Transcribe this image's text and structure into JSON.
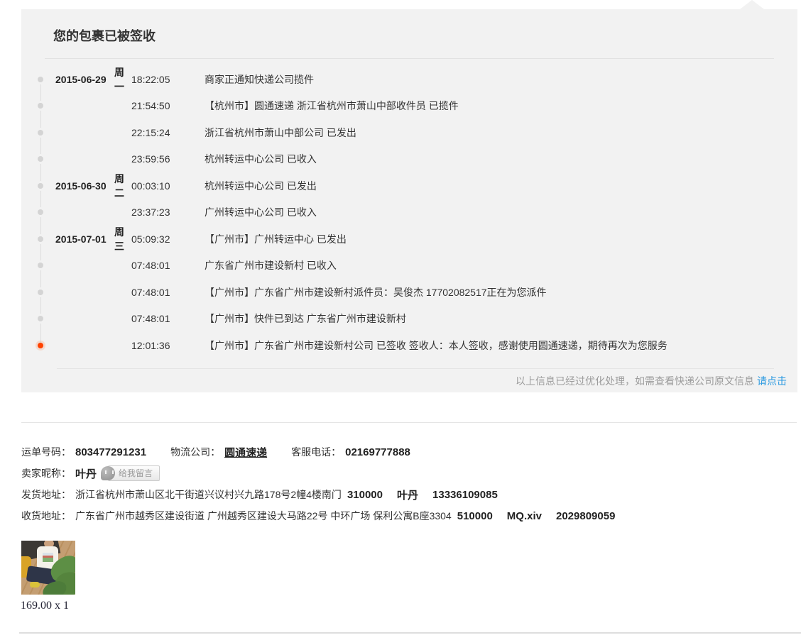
{
  "colors": {
    "box_bg": "#f2f2f2",
    "link_blue": "#2898e0",
    "active_dot": "#ff4200"
  },
  "header": {
    "title": "您的包裹已被签收"
  },
  "timeline": [
    {
      "date": "2015-06-29",
      "weekday": "周一",
      "time": "18:22:05",
      "message": "商家正通知快递公司揽件",
      "active": false
    },
    {
      "date": "",
      "weekday": "",
      "time": "21:54:50",
      "message": "【杭州市】圆通速递 浙江省杭州市萧山中部收件员 已揽件",
      "active": false
    },
    {
      "date": "",
      "weekday": "",
      "time": "22:15:24",
      "message": "浙江省杭州市萧山中部公司 已发出",
      "active": false
    },
    {
      "date": "",
      "weekday": "",
      "time": "23:59:56",
      "message": "杭州转运中心公司 已收入",
      "active": false
    },
    {
      "date": "2015-06-30",
      "weekday": "周二",
      "time": "00:03:10",
      "message": "杭州转运中心公司 已发出",
      "active": false
    },
    {
      "date": "",
      "weekday": "",
      "time": "23:37:23",
      "message": "广州转运中心公司 已收入",
      "active": false
    },
    {
      "date": "2015-07-01",
      "weekday": "周三",
      "time": "05:09:32",
      "message": "【广州市】广州转运中心 已发出",
      "active": false
    },
    {
      "date": "",
      "weekday": "",
      "time": "07:48:01",
      "message": "广东省广州市建设新村 已收入",
      "active": false
    },
    {
      "date": "",
      "weekday": "",
      "time": "07:48:01",
      "message": "【广州市】广东省广州市建设新村派件员：吴俊杰 17702082517正在为您派件",
      "active": false
    },
    {
      "date": "",
      "weekday": "",
      "time": "07:48:01",
      "message": "【广州市】快件已到达 广东省广州市建设新村",
      "active": false
    },
    {
      "date": "",
      "weekday": "",
      "time": "12:01:36",
      "message": "【广州市】广东省广州市建设新村公司 已签收 签收人：本人签收，感谢使用圆通速递，期待再次为您服务",
      "active": true
    }
  ],
  "box_footer": {
    "notice": "以上信息已经过优化处理，如需查看快递公司原文信息",
    "link_label": "请点击"
  },
  "details": {
    "waybill": {
      "label": "运单号码：",
      "value": "803477291231"
    },
    "company": {
      "label": "物流公司：",
      "value": "圆通速递"
    },
    "service_phone": {
      "label": "客服电话：",
      "value": "02169777888"
    },
    "seller": {
      "label": "卖家昵称：",
      "value": "叶丹"
    },
    "message_button_label": "给我留言",
    "ship_from": {
      "label": "发货地址：",
      "address": "浙江省杭州市萧山区北干街道兴议村兴九路178号2幢4楼南门",
      "zip": "310000",
      "name": "叶丹",
      "phone": "13336109085"
    },
    "ship_to": {
      "label": "收货地址：",
      "address": "广东省广州市越秀区建设街道 广州越秀区建设大马路22号 中环广场 保利公寓B座3304",
      "zip": "510000",
      "name": "MQ.xiv",
      "phone": "2029809059"
    }
  },
  "product": {
    "price_qty": "169.00 x 1"
  }
}
